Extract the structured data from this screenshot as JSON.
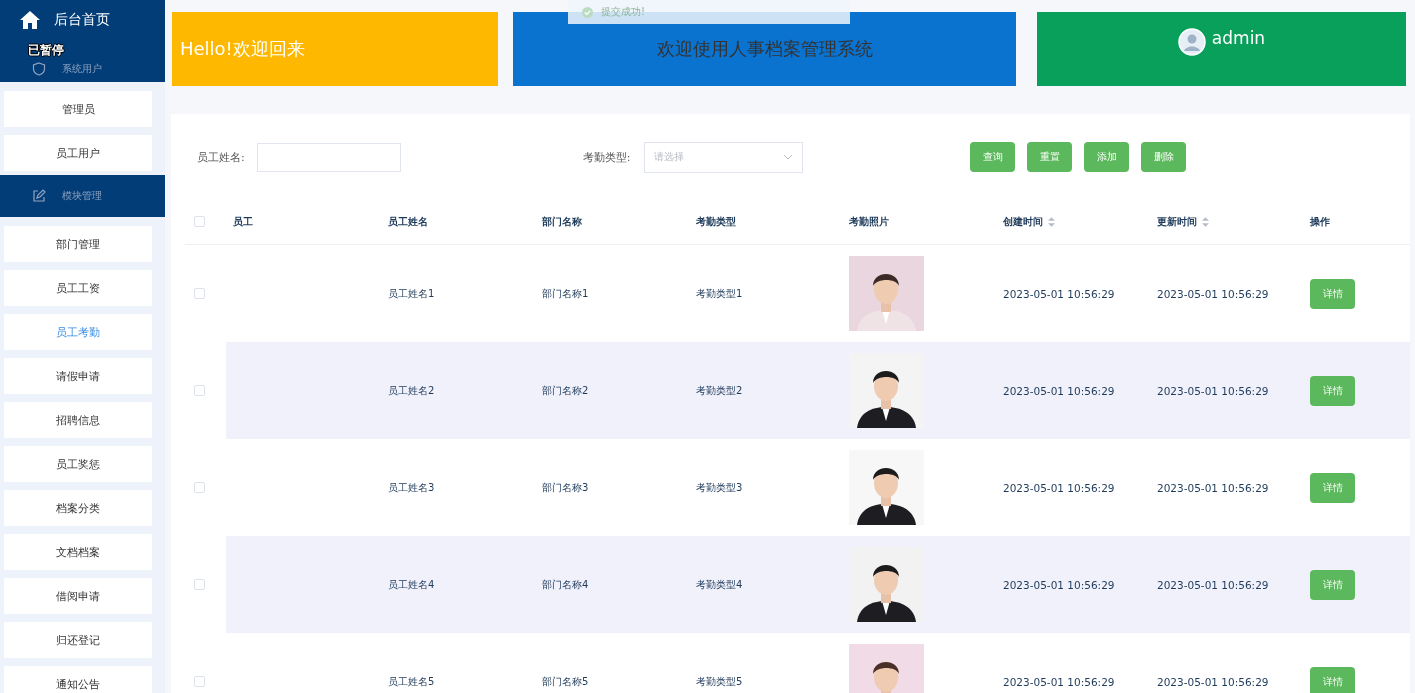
{
  "sidebar": {
    "home": "后台首页",
    "paused_label": "已暂停",
    "groups": [
      {
        "title": "系统用户",
        "items": [
          {
            "label": "管理员",
            "selected": false
          },
          {
            "label": "员工用户",
            "selected": false
          }
        ]
      },
      {
        "title": "模块管理",
        "items": [
          {
            "label": "部门管理",
            "selected": false
          },
          {
            "label": "员工工资",
            "selected": false
          },
          {
            "label": "员工考勤",
            "selected": true
          },
          {
            "label": "请假申请",
            "selected": false
          },
          {
            "label": "招聘信息",
            "selected": false
          },
          {
            "label": "员工奖惩",
            "selected": false
          },
          {
            "label": "档案分类",
            "selected": false
          },
          {
            "label": "文档档案",
            "selected": false
          },
          {
            "label": "借阅申请",
            "selected": false
          },
          {
            "label": "归还登记",
            "selected": false
          },
          {
            "label": "通知公告",
            "selected": false
          }
        ]
      }
    ]
  },
  "toast": "提交成功!",
  "banners": {
    "greeting": "Hello!欢迎回来",
    "system_title": "欢迎使用人事档案管理系统",
    "user": "admin"
  },
  "filters": {
    "name_label": "员工姓名:",
    "type_label": "考勤类型:",
    "type_placeholder": "请选择",
    "buttons": [
      "查询",
      "重置",
      "添加",
      "删除"
    ]
  },
  "table": {
    "select_all_checked": false,
    "columns": [
      {
        "label": "员工",
        "sortable": false
      },
      {
        "label": "员工姓名",
        "sortable": false
      },
      {
        "label": "部门名称",
        "sortable": false
      },
      {
        "label": "考勤类型",
        "sortable": false
      },
      {
        "label": "考勤照片",
        "sortable": false
      },
      {
        "label": "创建时间",
        "sortable": true
      },
      {
        "label": "更新时间",
        "sortable": true
      },
      {
        "label": "操作",
        "sortable": false
      }
    ],
    "rows": [
      {
        "checked": false,
        "name": "员工姓名1",
        "dept": "部门名称1",
        "type": "考勤类型1",
        "created": "2023-05-01 10:56:29",
        "updated": "2023-05-01 10:56:29",
        "action": "详情"
      },
      {
        "checked": false,
        "name": "员工姓名2",
        "dept": "部门名称2",
        "type": "考勤类型2",
        "created": "2023-05-01 10:56:29",
        "updated": "2023-05-01 10:56:29",
        "action": "详情"
      },
      {
        "checked": false,
        "name": "员工姓名3",
        "dept": "部门名称3",
        "type": "考勤类型3",
        "created": "2023-05-01 10:56:29",
        "updated": "2023-05-01 10:56:29",
        "action": "详情"
      },
      {
        "checked": false,
        "name": "员工姓名4",
        "dept": "部门名称4",
        "type": "考勤类型4",
        "created": "2023-05-01 10:56:29",
        "updated": "2023-05-01 10:56:29",
        "action": "详情"
      },
      {
        "checked": false,
        "name": "员工姓名5",
        "dept": "部门名称5",
        "type": "考勤类型5",
        "created": "2023-05-01 10:56:29",
        "updated": "2023-05-01 10:56:29",
        "action": "详情"
      }
    ]
  }
}
